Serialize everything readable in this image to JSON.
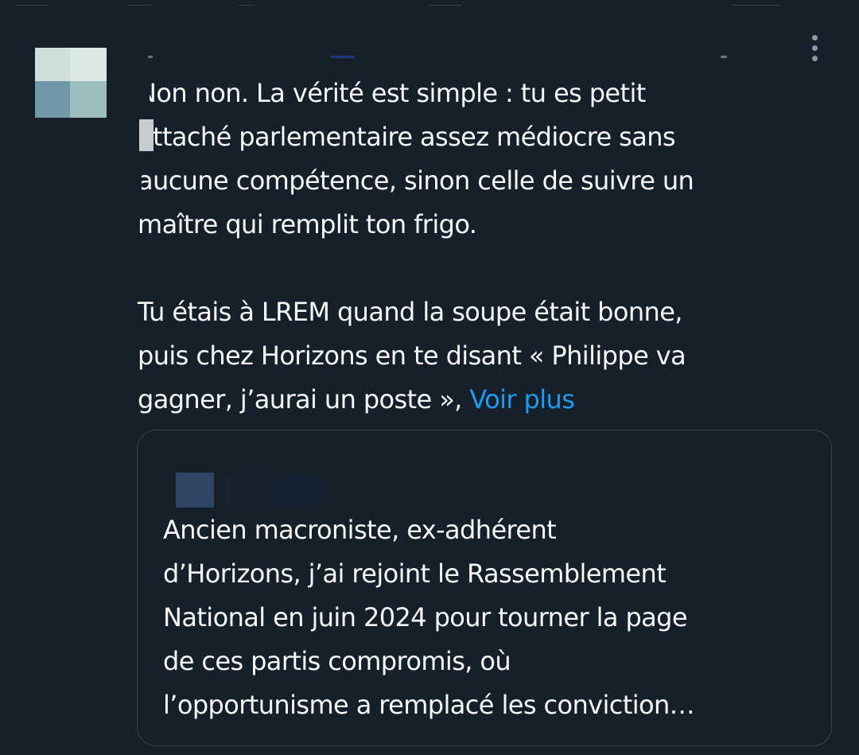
{
  "reply": {
    "lines": [
      "Non non. La vérité est simple : tu es petit",
      "attaché parlementaire assez médiocre sans",
      "aucune compétence, sinon celle de suivre un",
      "maître qui remplit ton frigo.",
      "",
      "Tu étais à LREM quand la soupe était bonne,",
      "puis chez Horizons en te disant « Philippe va",
      "gagner, j’aurai un poste »,"
    ],
    "voir_plus": "Voir plus"
  },
  "quote": {
    "text": "Ancien macroniste, ex-adhérent\nd’Horizons, j’ai rejoint le Rassemblement\nNational en juin 2024 pour tourner la page\nde ces partis compromis, où\nl’opportunisme a remplacé les conviction…"
  },
  "icons": {
    "more": "more-vertical-icon"
  },
  "colors": {
    "background": "#15202b",
    "text": "#f7f9f9",
    "link": "#1d9bf0",
    "border": "#38444d",
    "icon_muted": "#8b98a5"
  }
}
